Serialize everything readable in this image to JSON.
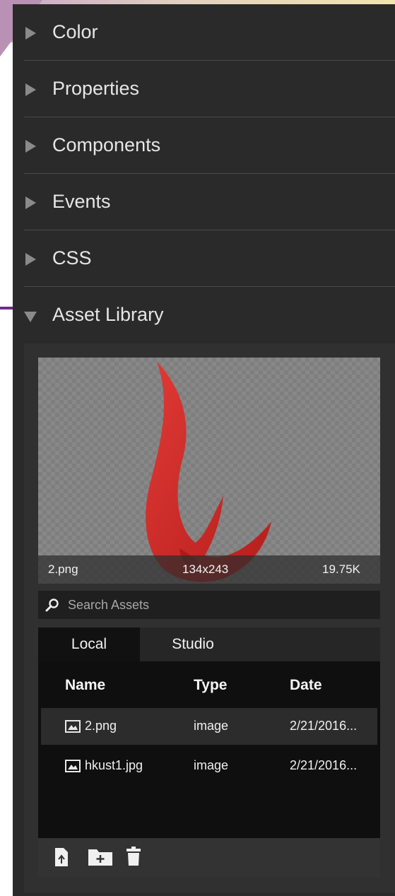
{
  "sections": [
    {
      "label": "Color",
      "expanded": false
    },
    {
      "label": "Properties",
      "expanded": false
    },
    {
      "label": "Components",
      "expanded": false
    },
    {
      "label": "Events",
      "expanded": false
    },
    {
      "label": "CSS",
      "expanded": false
    },
    {
      "label": "Asset Library",
      "expanded": true
    }
  ],
  "preview": {
    "filename": "2.png",
    "dimensions": "134x243",
    "size": "19.75K"
  },
  "search": {
    "placeholder": "Search Assets"
  },
  "tabs": [
    "Local",
    "Studio"
  ],
  "active_tab": "Local",
  "columns": [
    "Name",
    "Type",
    "Date"
  ],
  "assets": [
    {
      "name": "2.png",
      "type": "image",
      "date": "2/21/2016...",
      "selected": true
    },
    {
      "name": "hkust1.jpg",
      "type": "image",
      "date": "2/21/2016...",
      "selected": false
    }
  ],
  "toolbar_icons": [
    "upload-file-icon",
    "new-folder-icon",
    "delete-icon"
  ],
  "colors": {
    "panel_bg": "#2a2a2a",
    "list_bg": "#0f0f0f",
    "text": "#e6e6e6",
    "annotation_arrow": "#6b2d8c",
    "preview_asset": "#d42a27"
  }
}
